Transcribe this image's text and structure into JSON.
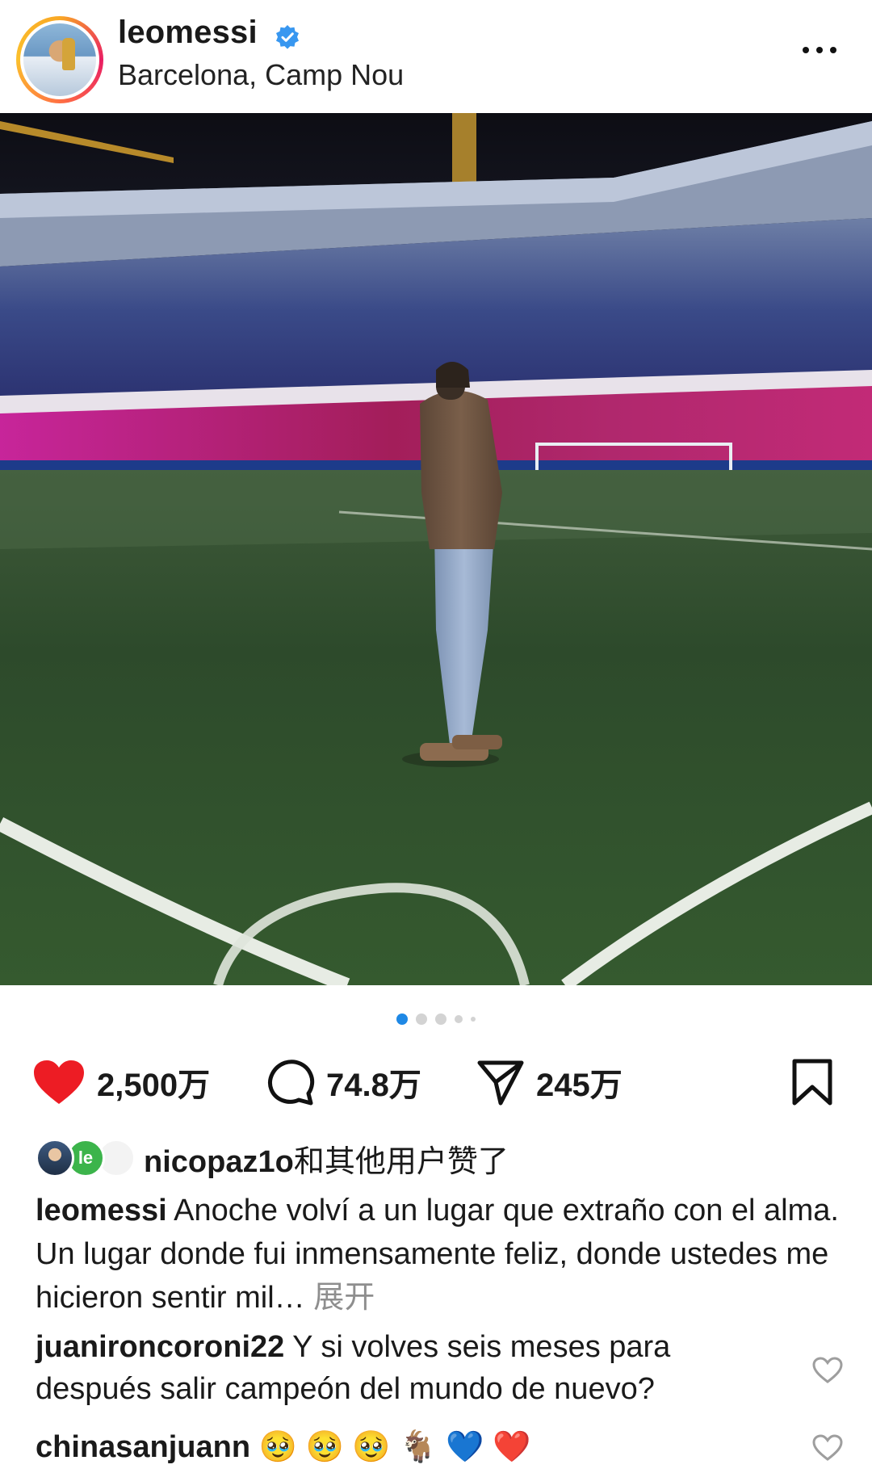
{
  "post_header": {
    "username": "leomessi",
    "location": "Barcelona, Camp Nou",
    "verified_icon": "verified-badge-icon",
    "more_icon": "more-horizontal-icon"
  },
  "carousel": {
    "total_dots": 5,
    "active_index": 0
  },
  "actions": {
    "likes": "2,500万",
    "comments": "74.8万",
    "shares": "245万"
  },
  "liked_by": {
    "user": "nicopaz1o",
    "suffix": "和其他用户赞了",
    "mini_avatar_2_text": "le"
  },
  "caption": {
    "username": "leomessi",
    "text": "Anoche volví a un lugar que extraño con el alma. Un lugar donde fui inmensamente feliz, donde ustedes me hicieron sentir mil…",
    "expand_label": "展开"
  },
  "comments": [
    {
      "username": "juanironcoroni22",
      "text": "Y si volves seis meses para después salir campeón del mundo de nuevo?"
    },
    {
      "username": "chinasanjuann",
      "text": "🥹 🥹 🥹 🐐 💙 ❤️"
    }
  ],
  "colors": {
    "like_red": "#ed1c24",
    "active_dot": "#1e88e5",
    "verified_blue": "#3897f0"
  }
}
